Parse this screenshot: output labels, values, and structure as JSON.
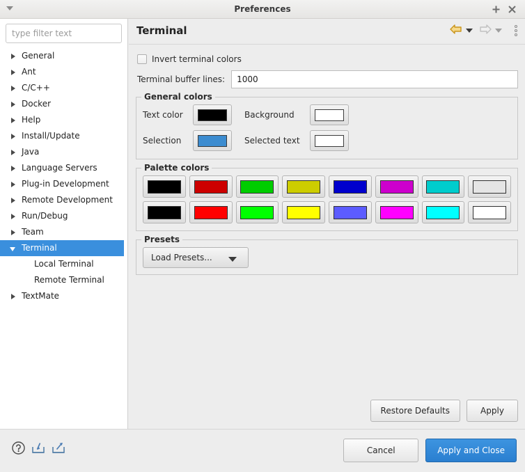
{
  "window": {
    "title": "Preferences",
    "menu_icon": "caret-down-icon",
    "maximize_icon": "plus-icon",
    "close_icon": "close-icon"
  },
  "sidebar": {
    "filter": {
      "placeholder": "type filter text",
      "value": ""
    },
    "items": [
      {
        "label": "General",
        "level": 0,
        "expandable": true,
        "selected": false
      },
      {
        "label": "Ant",
        "level": 0,
        "expandable": true,
        "selected": false
      },
      {
        "label": "C/C++",
        "level": 0,
        "expandable": true,
        "selected": false
      },
      {
        "label": "Docker",
        "level": 0,
        "expandable": true,
        "selected": false
      },
      {
        "label": "Help",
        "level": 0,
        "expandable": true,
        "selected": false
      },
      {
        "label": "Install/Update",
        "level": 0,
        "expandable": true,
        "selected": false
      },
      {
        "label": "Java",
        "level": 0,
        "expandable": true,
        "selected": false
      },
      {
        "label": "Language Servers",
        "level": 0,
        "expandable": true,
        "selected": false
      },
      {
        "label": "Plug-in Development",
        "level": 0,
        "expandable": true,
        "selected": false
      },
      {
        "label": "Remote Development",
        "level": 0,
        "expandable": true,
        "selected": false
      },
      {
        "label": "Run/Debug",
        "level": 0,
        "expandable": true,
        "selected": false
      },
      {
        "label": "Team",
        "level": 0,
        "expandable": true,
        "selected": false
      },
      {
        "label": "Terminal",
        "level": 0,
        "expandable": true,
        "selected": true
      },
      {
        "label": "Local Terminal",
        "level": 1,
        "expandable": false,
        "selected": false
      },
      {
        "label": "Remote Terminal",
        "level": 1,
        "expandable": false,
        "selected": false
      },
      {
        "label": "TextMate",
        "level": 0,
        "expandable": true,
        "selected": false
      }
    ],
    "selection_color": "#3a8fdd"
  },
  "content": {
    "title": "Terminal",
    "nav": {
      "back_icon": "back-arrow-icon",
      "back_dropdown_icon": "chevron-down-icon",
      "forward_icon": "forward-arrow-icon",
      "forward_dropdown_icon": "chevron-down-icon",
      "menu_icon": "vertical-dots-icon",
      "back_color": "#d8a219",
      "forward_color": "#c8c8c8"
    },
    "invert_checkbox": {
      "label": "Invert terminal colors",
      "checked": false
    },
    "buffer_lines": {
      "label": "Terminal buffer lines:",
      "value": "1000"
    },
    "general_colors": {
      "title": "General colors",
      "entries": [
        {
          "label": "Text color",
          "color": "#000000"
        },
        {
          "label": "Background",
          "color": "#ffffff"
        },
        {
          "label": "Selection",
          "color": "#3c8cd0"
        },
        {
          "label": "Selected text",
          "color": "#ffffff"
        }
      ]
    },
    "palette_colors": {
      "title": "Palette colors",
      "row1": [
        "#000000",
        "#cd0000",
        "#00cd00",
        "#cdcd00",
        "#0000cd",
        "#cd00cd",
        "#00cdcd",
        "#e5e5e5"
      ],
      "row2": [
        "#000000",
        "#ff0000",
        "#00ff00",
        "#ffff00",
        "#5c5cff",
        "#ff00ff",
        "#00ffff",
        "#ffffff"
      ]
    },
    "presets": {
      "title": "Presets",
      "button_label": "Load Presets...",
      "dropdown_icon": "chevron-down-icon"
    },
    "restore_defaults_label": "Restore Defaults",
    "apply_label": "Apply"
  },
  "footer": {
    "help_icon": "help-question-icon",
    "import_icon": "import-icon",
    "export_icon": "export-icon",
    "cancel_label": "Cancel",
    "apply_and_close_label": "Apply and Close",
    "primary_color": "#2a7fd0"
  }
}
